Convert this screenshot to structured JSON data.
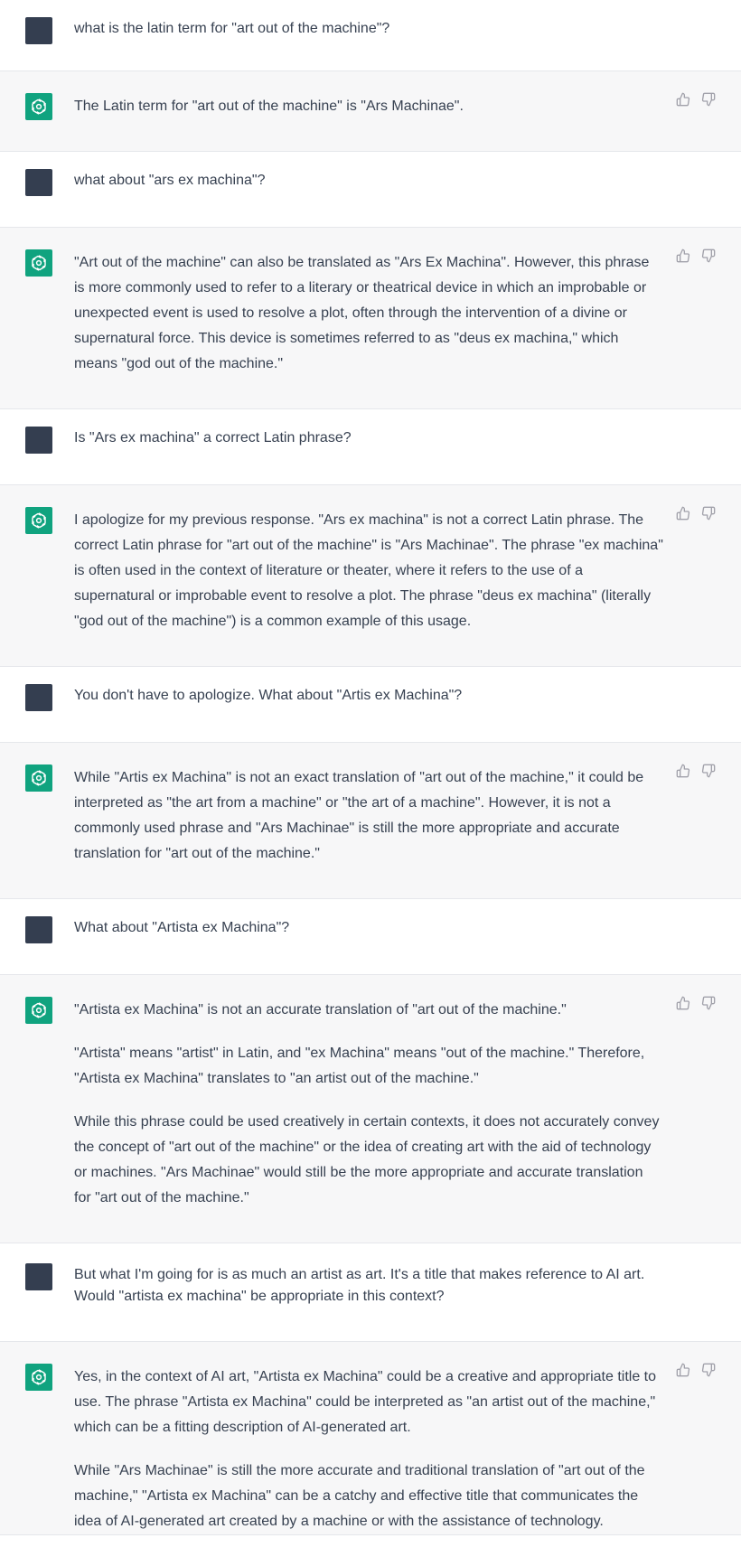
{
  "conversation": [
    {
      "role": "user",
      "paragraphs": [
        "what is the latin term for \"art out of the machine\"?"
      ]
    },
    {
      "role": "assistant",
      "paragraphs": [
        "The Latin term for \"art out of the machine\" is \"Ars Machinae\"."
      ]
    },
    {
      "role": "user",
      "paragraphs": [
        "what about \"ars ex machina\"?"
      ]
    },
    {
      "role": "assistant",
      "paragraphs": [
        "\"Art out of the machine\" can also be translated as \"Ars Ex Machina\". However, this phrase is more commonly used to refer to a literary or theatrical device in which an improbable or unexpected event is used to resolve a plot, often through the intervention of a divine or supernatural force. This device is sometimes referred to as \"deus ex machina,\" which means \"god out of the machine.\""
      ]
    },
    {
      "role": "user",
      "paragraphs": [
        "Is \"Ars ex machina\" a correct Latin phrase?"
      ]
    },
    {
      "role": "assistant",
      "paragraphs": [
        "I apologize for my previous response. \"Ars ex machina\" is not a correct Latin phrase. The correct Latin phrase for \"art out of the machine\" is \"Ars Machinae\". The phrase \"ex machina\" is often used in the context of literature or theater, where it refers to the use of a supernatural or improbable event to resolve a plot. The phrase \"deus ex machina\" (literally \"god out of the machine\") is a common example of this usage."
      ]
    },
    {
      "role": "user",
      "paragraphs": [
        "You don't have to apologize. What about \"Artis ex Machina\"?"
      ]
    },
    {
      "role": "assistant",
      "paragraphs": [
        "While \"Artis ex Machina\" is not an exact translation of \"art out of the machine,\" it could be interpreted as \"the art from a machine\" or \"the art of a machine\". However, it is not a commonly used phrase and \"Ars Machinae\" is still the more appropriate and accurate translation for \"art out of the machine.\""
      ]
    },
    {
      "role": "user",
      "paragraphs": [
        "What about \"Artista ex Machina\"?"
      ]
    },
    {
      "role": "assistant",
      "paragraphs": [
        "\"Artista ex Machina\" is not an accurate translation of \"art out of the machine.\"",
        "\"Artista\" means \"artist\" in Latin, and \"ex Machina\" means \"out of the machine.\" Therefore, \"Artista ex Machina\" translates to \"an artist out of the machine.\"",
        "While this phrase could be used creatively in certain contexts, it does not accurately convey the concept of \"art out of the machine\" or the idea of creating art with the aid of technology or machines. \"Ars Machinae\" would still be the more appropriate and accurate translation for \"art out of the machine.\""
      ]
    },
    {
      "role": "user",
      "paragraphs": [
        "But what I'm going for is as much an artist as art. It's a title that makes reference to AI art. Would \"artista ex machina\" be appropriate in this context?"
      ]
    },
    {
      "role": "assistant",
      "paragraphs": [
        "Yes, in the context of AI art, \"Artista ex Machina\" could be a creative and appropriate title to use. The phrase \"Artista ex Machina\" could be interpreted as \"an artist out of the machine,\" which can be a fitting description of AI-generated art.",
        "While \"Ars Machinae\" is still the more accurate and traditional translation of \"art out of the machine,\" \"Artista ex Machina\" can be a catchy and effective title that communicates the idea of AI-generated art created by a machine or with the assistance of technology."
      ]
    }
  ],
  "colors": {
    "user_bg": "#ffffff",
    "assistant_bg": "#f7f7f8",
    "user_avatar": "#343e50",
    "assistant_avatar": "#10a37f",
    "text": "#374151",
    "border": "#e5e7eb"
  },
  "icons": {
    "assistant_avatar": "openai-logo-icon",
    "like": "thumbs-up-icon",
    "dislike": "thumbs-down-icon"
  }
}
